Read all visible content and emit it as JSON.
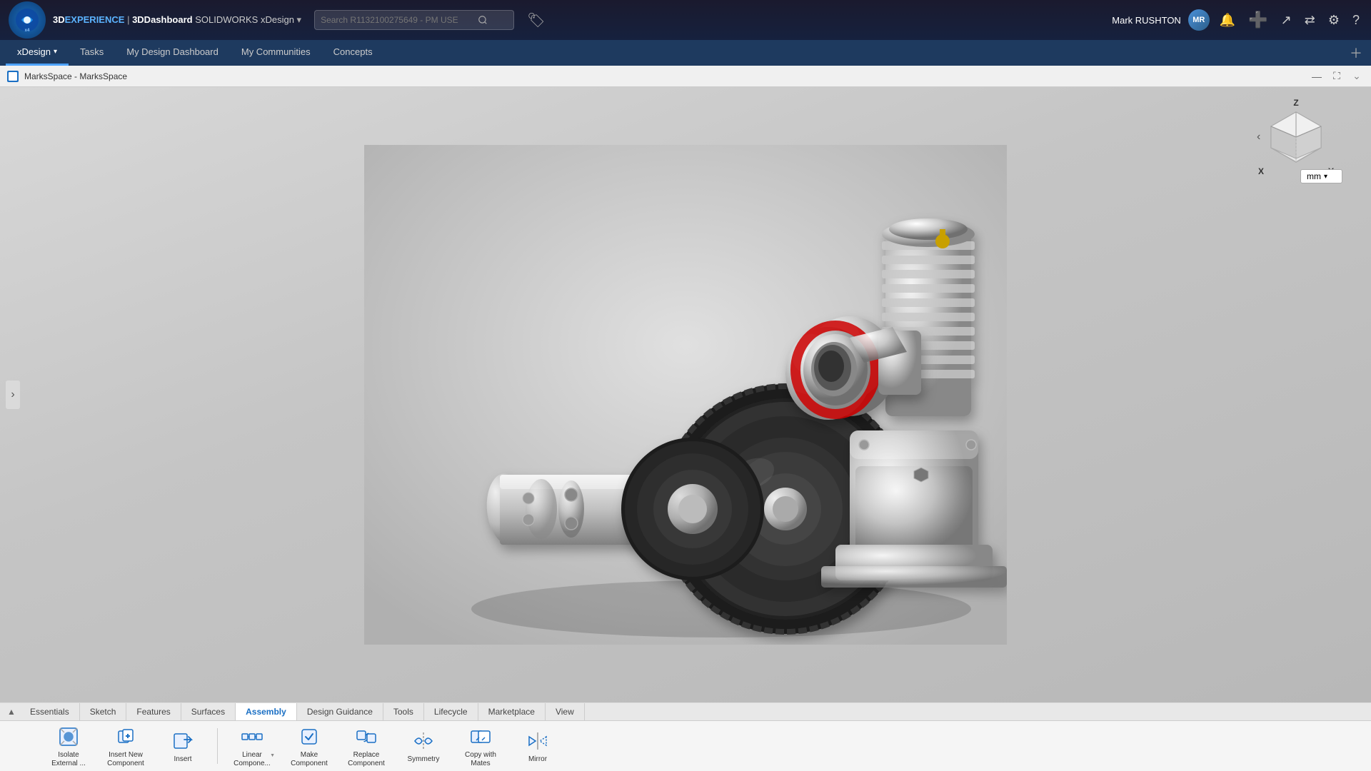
{
  "app": {
    "platform": "3DEXPERIENCE",
    "separator": " | ",
    "product": "3DDashboard",
    "suite": "SOLIDWORKS xDesign",
    "dropdown_arrow": "▾"
  },
  "search": {
    "placeholder": "Search R1132100275649 - PM USE"
  },
  "user": {
    "name": "Mark RUSHTON",
    "initials": "MR"
  },
  "nav": {
    "items": [
      {
        "id": "xdesign",
        "label": "xDesign",
        "active": true,
        "has_dropdown": true
      },
      {
        "id": "tasks",
        "label": "Tasks",
        "active": false,
        "has_dropdown": false
      },
      {
        "id": "my-design-dashboard",
        "label": "My Design Dashboard",
        "active": false,
        "has_dropdown": false
      },
      {
        "id": "my-communities",
        "label": "My Communities",
        "active": false,
        "has_dropdown": false
      },
      {
        "id": "concepts",
        "label": "Concepts",
        "active": false,
        "has_dropdown": false
      }
    ]
  },
  "window": {
    "title": "MarksSpace - MarksSpace"
  },
  "viewport": {
    "axes": {
      "z": "Z",
      "x": "X",
      "y": "Y"
    },
    "unit": "mm"
  },
  "toolbar_tabs": [
    {
      "id": "essentials",
      "label": "Essentials",
      "active": false
    },
    {
      "id": "sketch",
      "label": "Sketch",
      "active": false
    },
    {
      "id": "features",
      "label": "Features",
      "active": false
    },
    {
      "id": "surfaces",
      "label": "Surfaces",
      "active": false
    },
    {
      "id": "assembly",
      "label": "Assembly",
      "active": true
    },
    {
      "id": "design-guidance",
      "label": "Design Guidance",
      "active": false
    },
    {
      "id": "tools",
      "label": "Tools",
      "active": false
    },
    {
      "id": "lifecycle",
      "label": "Lifecycle",
      "active": false
    },
    {
      "id": "marketplace",
      "label": "Marketplace",
      "active": false
    },
    {
      "id": "view",
      "label": "View",
      "active": false
    }
  ],
  "toolbar_items": [
    {
      "id": "isolate-external",
      "label": "Isolate External ...",
      "icon": "isolate"
    },
    {
      "id": "insert-new-component",
      "label": "Insert New Component",
      "icon": "insert-new"
    },
    {
      "id": "insert",
      "label": "Insert",
      "icon": "insert"
    },
    {
      "id": "linear-component",
      "label": "Linear Compone...",
      "icon": "linear-component",
      "has_arrow": true
    },
    {
      "id": "make-component",
      "label": "Make Component",
      "icon": "make-component"
    },
    {
      "id": "replace-component",
      "label": "Replace Component",
      "icon": "replace-component"
    },
    {
      "id": "symmetry",
      "label": "Symmetry",
      "icon": "symmetry"
    },
    {
      "id": "copy-with-mates",
      "label": "Copy with Mates",
      "icon": "copy-mates"
    },
    {
      "id": "mirror",
      "label": "Mirror",
      "icon": "mirror"
    }
  ]
}
